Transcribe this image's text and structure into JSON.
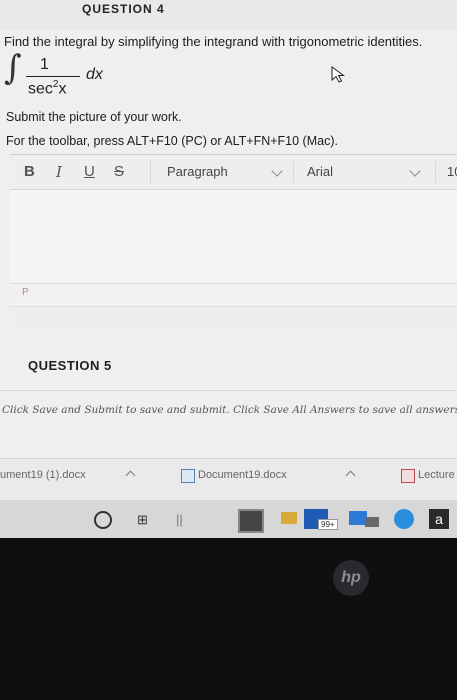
{
  "header": {
    "partial_title": "QUESTION 4"
  },
  "question": {
    "instruction": "Find the integral by simplifying the integrand with trigonometric identities.",
    "integrand_numerator": "1",
    "integrand_denominator": "sec",
    "denominator_power": "2",
    "denominator_var": "x",
    "differential": "dx"
  },
  "editor": {
    "submit_prompt": "Submit the picture of your work.",
    "toolbar_hint": "For the toolbar, press ALT+F10 (PC) or ALT+FN+F10 (Mac).",
    "bold": "B",
    "italic": "I",
    "underline": "U",
    "strikethrough": "S",
    "paragraph_select": "Paragraph",
    "font_select": "Arial",
    "size_select": "10",
    "status_path": "P"
  },
  "question5": {
    "heading": "QUESTION 5"
  },
  "footer": {
    "save_note": "Click Save and Submit to save and submit. Click Save All Answers to save all answers."
  },
  "downloads": {
    "item1": "ument19 (1).docx",
    "item2": "Document19.docx",
    "item3": "Lecture"
  },
  "taskbar": {
    "onedrive_badge": "99+",
    "amazon_label": "a"
  },
  "device": {
    "logo": "hp"
  }
}
